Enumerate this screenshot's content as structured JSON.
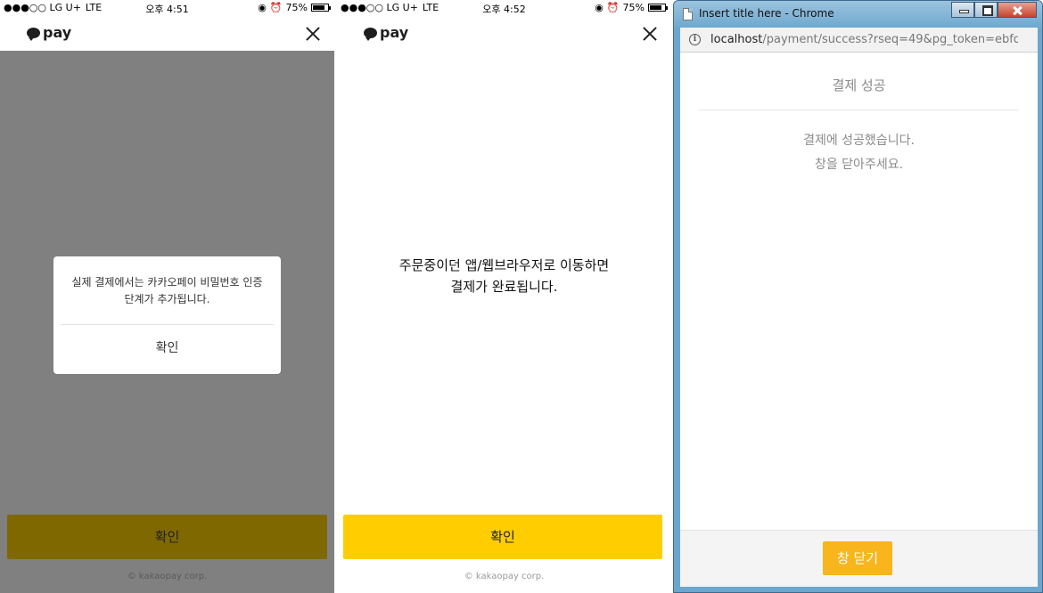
{
  "phone1": {
    "status": {
      "carrier": "●●●○○ LG U+",
      "network": "LTE",
      "time": "오후 4:51",
      "battery": "75%",
      "battery_level": 0.75
    },
    "header": {
      "logo_text": "pay"
    },
    "dialog": {
      "message": "실제 결제에서는 카카오페이 비밀번호 인증\n단계가 추가됩니다.",
      "ok_label": "확인"
    },
    "confirm_label": "확인",
    "copyright": "© kakaopay corp."
  },
  "phone2": {
    "status": {
      "carrier": "●●●○○ LG U+",
      "network": "LTE",
      "time": "오후 4:52",
      "battery": "75%",
      "battery_level": 0.75
    },
    "header": {
      "logo_text": "pay"
    },
    "message": "주문중이던 앱/웹브라우저로 이동하면\n결제가 완료됩니다.",
    "confirm_label": "확인",
    "copyright": "© kakaopay corp."
  },
  "chrome": {
    "title": "Insert title here - Chrome",
    "url_host": "localhost",
    "url_rest": "/payment/success?rseq=49&pg_token=ebfd...",
    "page": {
      "title": "결제 성공",
      "message": "결제에 성공했습니다.\n창을 닫아주세요.",
      "close_label": "창 닫기"
    }
  },
  "colors": {
    "kakao_yellow": "#ffcd00",
    "dimmed_yellow": "#806800",
    "overlay": "#808080",
    "close_button": "#f8b51c"
  }
}
